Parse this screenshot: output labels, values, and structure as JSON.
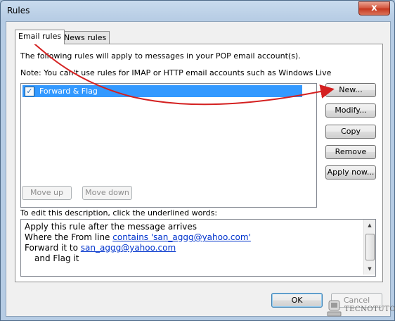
{
  "window": {
    "title": "Rules",
    "close_glyph": "x"
  },
  "tabs": [
    {
      "label": "Email rules",
      "active": true
    },
    {
      "label": "News rules",
      "active": false
    }
  ],
  "intro": {
    "line1": "The following rules will apply to messages in your POP email account(s).",
    "line2": "Note: You can't use rules for IMAP or HTTP email accounts such as Windows Live"
  },
  "rules": [
    {
      "name": "Forward & Flag",
      "checked": true
    }
  ],
  "side_buttons": {
    "new": "New...",
    "modify": "Modify...",
    "copy": "Copy",
    "remove": "Remove",
    "apply_now": "Apply now..."
  },
  "move_buttons": {
    "up": "Move up",
    "down": "Move down"
  },
  "description": {
    "label": "To edit this description, click the underlined words:",
    "line1": "Apply this rule after the message arrives",
    "line2_prefix": "Where the From line ",
    "line2_link": "contains 'san_aggg@yahoo.com'",
    "line3_prefix": "Forward it to ",
    "line3_link": "san_aggg@yahoo.com",
    "line4": "and Flag it"
  },
  "dialog_buttons": {
    "ok": "OK",
    "cancel": "Cancel"
  },
  "watermark": {
    "text": "TECNOTUTO"
  },
  "colors": {
    "annotation_arrow": "#d42020",
    "selection": "#3399ff",
    "link": "#0033cc"
  },
  "icons": {
    "checkbox": "check-icon",
    "scroll_up": "chevron-up-icon",
    "scroll_down": "chevron-down-icon",
    "watermark_logo": "tecnotuto-logo-icon"
  }
}
